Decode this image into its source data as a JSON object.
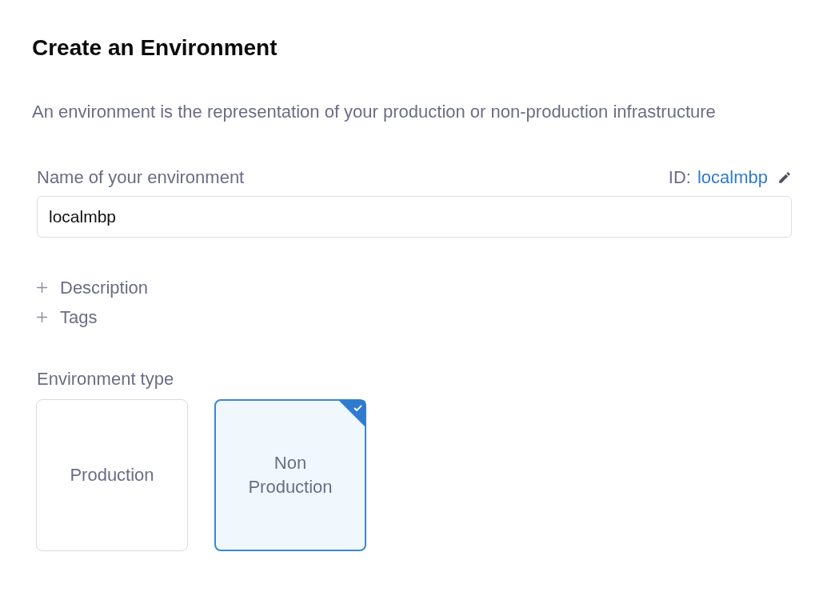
{
  "title": "Create an Environment",
  "description": "An environment is the representation of your production or non-production infrastructure",
  "name_field": {
    "label": "Name of your environment",
    "id_label": "ID:",
    "id_value": "localmbp",
    "value": "localmbp"
  },
  "expanders": [
    {
      "label": "Description"
    },
    {
      "label": "Tags"
    }
  ],
  "environment_type": {
    "label": "Environment type",
    "options": [
      {
        "label": "Production",
        "selected": false
      },
      {
        "label": "Non Production",
        "selected": true
      }
    ]
  }
}
